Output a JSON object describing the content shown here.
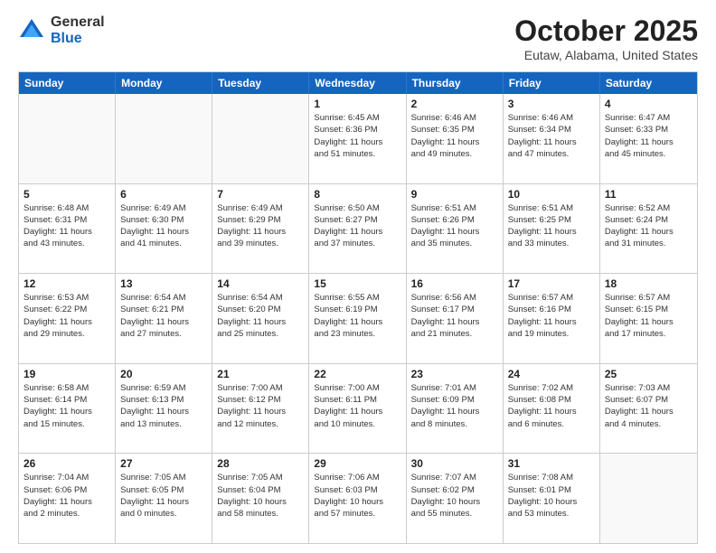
{
  "logo": {
    "general": "General",
    "blue": "Blue"
  },
  "title": "October 2025",
  "subtitle": "Eutaw, Alabama, United States",
  "days_of_week": [
    "Sunday",
    "Monday",
    "Tuesday",
    "Wednesday",
    "Thursday",
    "Friday",
    "Saturday"
  ],
  "weeks": [
    [
      {
        "day": "",
        "info": ""
      },
      {
        "day": "",
        "info": ""
      },
      {
        "day": "",
        "info": ""
      },
      {
        "day": "1",
        "info": "Sunrise: 6:45 AM\nSunset: 6:36 PM\nDaylight: 11 hours\nand 51 minutes."
      },
      {
        "day": "2",
        "info": "Sunrise: 6:46 AM\nSunset: 6:35 PM\nDaylight: 11 hours\nand 49 minutes."
      },
      {
        "day": "3",
        "info": "Sunrise: 6:46 AM\nSunset: 6:34 PM\nDaylight: 11 hours\nand 47 minutes."
      },
      {
        "day": "4",
        "info": "Sunrise: 6:47 AM\nSunset: 6:33 PM\nDaylight: 11 hours\nand 45 minutes."
      }
    ],
    [
      {
        "day": "5",
        "info": "Sunrise: 6:48 AM\nSunset: 6:31 PM\nDaylight: 11 hours\nand 43 minutes."
      },
      {
        "day": "6",
        "info": "Sunrise: 6:49 AM\nSunset: 6:30 PM\nDaylight: 11 hours\nand 41 minutes."
      },
      {
        "day": "7",
        "info": "Sunrise: 6:49 AM\nSunset: 6:29 PM\nDaylight: 11 hours\nand 39 minutes."
      },
      {
        "day": "8",
        "info": "Sunrise: 6:50 AM\nSunset: 6:27 PM\nDaylight: 11 hours\nand 37 minutes."
      },
      {
        "day": "9",
        "info": "Sunrise: 6:51 AM\nSunset: 6:26 PM\nDaylight: 11 hours\nand 35 minutes."
      },
      {
        "day": "10",
        "info": "Sunrise: 6:51 AM\nSunset: 6:25 PM\nDaylight: 11 hours\nand 33 minutes."
      },
      {
        "day": "11",
        "info": "Sunrise: 6:52 AM\nSunset: 6:24 PM\nDaylight: 11 hours\nand 31 minutes."
      }
    ],
    [
      {
        "day": "12",
        "info": "Sunrise: 6:53 AM\nSunset: 6:22 PM\nDaylight: 11 hours\nand 29 minutes."
      },
      {
        "day": "13",
        "info": "Sunrise: 6:54 AM\nSunset: 6:21 PM\nDaylight: 11 hours\nand 27 minutes."
      },
      {
        "day": "14",
        "info": "Sunrise: 6:54 AM\nSunset: 6:20 PM\nDaylight: 11 hours\nand 25 minutes."
      },
      {
        "day": "15",
        "info": "Sunrise: 6:55 AM\nSunset: 6:19 PM\nDaylight: 11 hours\nand 23 minutes."
      },
      {
        "day": "16",
        "info": "Sunrise: 6:56 AM\nSunset: 6:17 PM\nDaylight: 11 hours\nand 21 minutes."
      },
      {
        "day": "17",
        "info": "Sunrise: 6:57 AM\nSunset: 6:16 PM\nDaylight: 11 hours\nand 19 minutes."
      },
      {
        "day": "18",
        "info": "Sunrise: 6:57 AM\nSunset: 6:15 PM\nDaylight: 11 hours\nand 17 minutes."
      }
    ],
    [
      {
        "day": "19",
        "info": "Sunrise: 6:58 AM\nSunset: 6:14 PM\nDaylight: 11 hours\nand 15 minutes."
      },
      {
        "day": "20",
        "info": "Sunrise: 6:59 AM\nSunset: 6:13 PM\nDaylight: 11 hours\nand 13 minutes."
      },
      {
        "day": "21",
        "info": "Sunrise: 7:00 AM\nSunset: 6:12 PM\nDaylight: 11 hours\nand 12 minutes."
      },
      {
        "day": "22",
        "info": "Sunrise: 7:00 AM\nSunset: 6:11 PM\nDaylight: 11 hours\nand 10 minutes."
      },
      {
        "day": "23",
        "info": "Sunrise: 7:01 AM\nSunset: 6:09 PM\nDaylight: 11 hours\nand 8 minutes."
      },
      {
        "day": "24",
        "info": "Sunrise: 7:02 AM\nSunset: 6:08 PM\nDaylight: 11 hours\nand 6 minutes."
      },
      {
        "day": "25",
        "info": "Sunrise: 7:03 AM\nSunset: 6:07 PM\nDaylight: 11 hours\nand 4 minutes."
      }
    ],
    [
      {
        "day": "26",
        "info": "Sunrise: 7:04 AM\nSunset: 6:06 PM\nDaylight: 11 hours\nand 2 minutes."
      },
      {
        "day": "27",
        "info": "Sunrise: 7:05 AM\nSunset: 6:05 PM\nDaylight: 11 hours\nand 0 minutes."
      },
      {
        "day": "28",
        "info": "Sunrise: 7:05 AM\nSunset: 6:04 PM\nDaylight: 10 hours\nand 58 minutes."
      },
      {
        "day": "29",
        "info": "Sunrise: 7:06 AM\nSunset: 6:03 PM\nDaylight: 10 hours\nand 57 minutes."
      },
      {
        "day": "30",
        "info": "Sunrise: 7:07 AM\nSunset: 6:02 PM\nDaylight: 10 hours\nand 55 minutes."
      },
      {
        "day": "31",
        "info": "Sunrise: 7:08 AM\nSunset: 6:01 PM\nDaylight: 10 hours\nand 53 minutes."
      },
      {
        "day": "",
        "info": ""
      }
    ]
  ]
}
